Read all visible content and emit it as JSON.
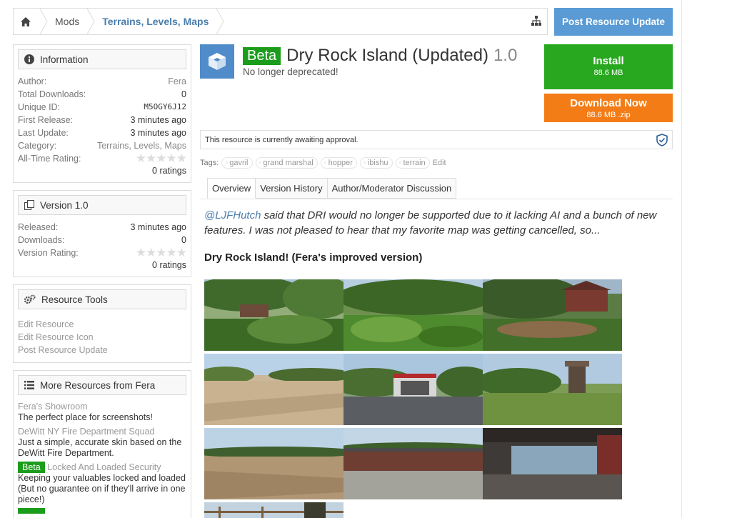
{
  "breadcrumb": {
    "items": [
      "Mods",
      "Terrains, Levels, Maps"
    ]
  },
  "header": {
    "post_update_label": "Post Resource Update"
  },
  "resource": {
    "badge": "Beta",
    "title": "Dry Rock Island (Updated)",
    "version": "1.0",
    "tagline": "No longer deprecated!"
  },
  "install": {
    "label": "Install",
    "size": "88.6 MB"
  },
  "download": {
    "label": "Download Now",
    "size": "88.6 MB .zip"
  },
  "notice": "This resource is currently awaiting approval.",
  "tags": {
    "label": "Tags:",
    "items": [
      "gavril",
      "grand marshal",
      "hopper",
      "ibishu",
      "terrain"
    ],
    "edit": "Edit"
  },
  "tabs": [
    "Overview",
    "Version History",
    "Author/Moderator Discussion"
  ],
  "description": {
    "mention": "@LJFHutch",
    "text": " said that DRI would no longer be supported due to it lacking AI and a bunch of new features. I was not pleased to hear that my favorite map was getting cancelled, so...",
    "heading": "Dry Rock Island! (Fera's improved version)"
  },
  "information": {
    "title": "Information",
    "rows": [
      {
        "k": "Author:",
        "v": "Fera"
      },
      {
        "k": "Total Downloads:",
        "v": "0"
      },
      {
        "k": "Unique ID:",
        "v": "M5OGY6J12"
      },
      {
        "k": "First Release:",
        "v": "3 minutes ago"
      },
      {
        "k": "Last Update:",
        "v": "3 minutes ago"
      },
      {
        "k": "Category:",
        "v": "Terrains, Levels, Maps"
      },
      {
        "k": "All-Time Rating:",
        "v": ""
      }
    ],
    "ratings": "0 ratings"
  },
  "version_block": {
    "title": "Version 1.0",
    "rows": [
      {
        "k": "Released:",
        "v": "3 minutes ago"
      },
      {
        "k": "Downloads:",
        "v": "0"
      },
      {
        "k": "Version Rating:",
        "v": ""
      }
    ],
    "ratings": "0 ratings"
  },
  "tools": {
    "title": "Resource Tools",
    "links": [
      "Edit Resource",
      "Edit Resource Icon",
      "Post Resource Update"
    ]
  },
  "more": {
    "title": "More Resources from Fera",
    "items": [
      {
        "title": "Fera's Showroom",
        "desc": "The perfect place for screenshots!"
      },
      {
        "title": "DeWitt NY Fire Department Squad",
        "desc": "Just a simple, accurate skin based on the DeWitt Fire Department."
      },
      {
        "badge": "Beta",
        "title": "Locked And Loaded Security",
        "desc": "Keeping your valuables locked and loaded (But no guarantee on if they'll arrive in one piece!)"
      }
    ]
  },
  "colors": {
    "accent": "#5a9bd5",
    "install": "#27a81e",
    "download": "#f47c16",
    "beta": "#1b9d1b"
  }
}
